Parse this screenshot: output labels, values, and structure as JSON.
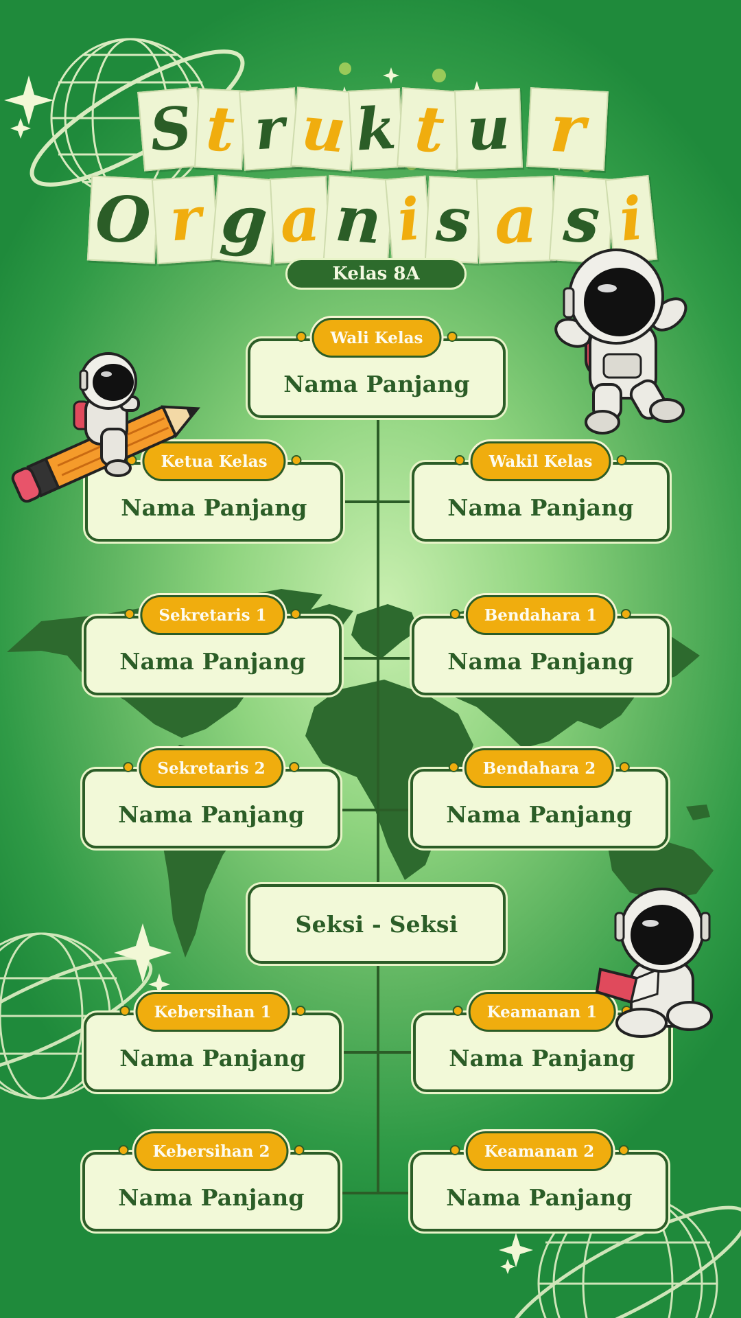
{
  "title": {
    "line1": "Struktur",
    "line2": "Organisasi",
    "subtitle": "Kelas 8A"
  },
  "org": {
    "head": {
      "role": "Wali Kelas",
      "name": "Nama Panjang"
    },
    "rows": [
      {
        "left": {
          "role": "Ketua Kelas",
          "name": "Nama Panjang"
        },
        "right": {
          "role": "Wakil Kelas",
          "name": "Nama Panjang"
        }
      },
      {
        "left": {
          "role": "Sekretaris 1",
          "name": "Nama Panjang"
        },
        "right": {
          "role": "Bendahara 1",
          "name": "Nama Panjang"
        }
      },
      {
        "left": {
          "role": "Sekretaris 2",
          "name": "Nama Panjang"
        },
        "right": {
          "role": "Bendahara 2",
          "name": "Nama Panjang"
        }
      }
    ],
    "section": {
      "label": "Seksi - Seksi"
    },
    "section_rows": [
      {
        "left": {
          "role": "Kebersihan 1",
          "name": "Nama Panjang"
        },
        "right": {
          "role": "Keamanan 1",
          "name": "Nama Panjang"
        }
      },
      {
        "left": {
          "role": "Kebersihan 2",
          "name": "Nama Panjang"
        },
        "right": {
          "role": "Keamanan 2",
          "name": "Nama Panjang"
        }
      }
    ]
  },
  "colors": {
    "dark_green": "#2b5d27",
    "card_fill": "#f2f9d8",
    "accent_yellow": "#f0ad0e",
    "background": "#5cb35f"
  },
  "decorations": [
    "globe-icon",
    "world-map",
    "astronaut-on-pencil",
    "astronaut-waving",
    "astronaut-reading",
    "sparkle-icon"
  ]
}
